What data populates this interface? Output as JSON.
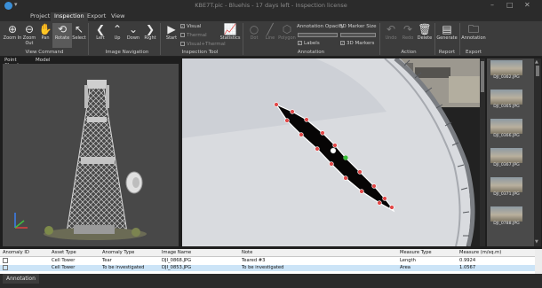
{
  "window": {
    "title": "KBE7T.pic - Bluehis - 17 days left - Inspection license",
    "minimize": "–",
    "maximize": "□",
    "close": "✕"
  },
  "menu": [
    "Project",
    "Inspection",
    "Export",
    "View"
  ],
  "ribbon": {
    "view_command": {
      "label": "View Command",
      "buttons": [
        {
          "label": "Zoom In",
          "icon": "⊕"
        },
        {
          "label": "Zoom Out",
          "icon": "⊖"
        },
        {
          "label": "Pan",
          "icon": "✋"
        },
        {
          "label": "Rotate",
          "icon": "⟲"
        },
        {
          "label": "Select",
          "icon": "↖"
        }
      ]
    },
    "image_navigation": {
      "label": "Image Navigation",
      "buttons": [
        {
          "label": "Left",
          "icon": "❮"
        },
        {
          "label": "Up",
          "icon": "⌃"
        },
        {
          "label": "Down",
          "icon": "⌄"
        },
        {
          "label": "Right",
          "icon": "❯"
        }
      ]
    },
    "inspection_tool": {
      "label": "Inspection Tool",
      "start_label": "Start",
      "visual_label": "Visual",
      "thermal_label": "Thermal",
      "visual_thermal_label": "Visual+Thermal",
      "statistics_label": "Statistics"
    },
    "annotation": {
      "label": "Annotation",
      "tools": [
        "Dot",
        "Line",
        "Polygon"
      ],
      "opacity_label": "Annotation Opacity",
      "labels_label": "Labels",
      "marker_size_label": "3D Marker Size",
      "markers_label": "3D Markers"
    },
    "action": {
      "label": "Action",
      "buttons": [
        {
          "label": "Undo",
          "icon": "↶"
        },
        {
          "label": "Redo",
          "icon": "↷"
        },
        {
          "label": "Delete",
          "icon": "🗑"
        }
      ]
    },
    "report": {
      "label": "Report",
      "generate_label": "Generate"
    },
    "export": {
      "label": "Export",
      "annotation_label": "Annotation"
    }
  },
  "left_tabs": [
    "Point Cloud",
    "Model"
  ],
  "thumbnails": [
    "DJI_0362.JPG",
    "DJI_0365.JPG",
    "DJI_0366.JPG",
    "DJI_0367.JPG",
    "DJI_0371.JPG",
    "DJI_0788.JPG"
  ],
  "table": {
    "headers": [
      "Anomaly ID",
      "Asset Type",
      "Anomaly Type",
      "Image Name",
      "Note",
      "Measure Type",
      "Measure (m/sq.m)"
    ],
    "rows": [
      [
        "",
        "Cell Tower",
        "Tear",
        "DJI_0868.JPG",
        "Teared #3",
        "Length",
        "0.9924"
      ],
      [
        "",
        "Cell Tower",
        "To be investigated",
        "DJI_0853.JPG",
        "To be investigated",
        "Area",
        "1.0567"
      ]
    ]
  },
  "bottom_tab": "Annotation",
  "colors": {
    "ribbon_bg": "#3c3c3c",
    "app_bg": "#1e1e1e",
    "annotation_point": "#e24848",
    "annotation_fill": "#070505"
  }
}
